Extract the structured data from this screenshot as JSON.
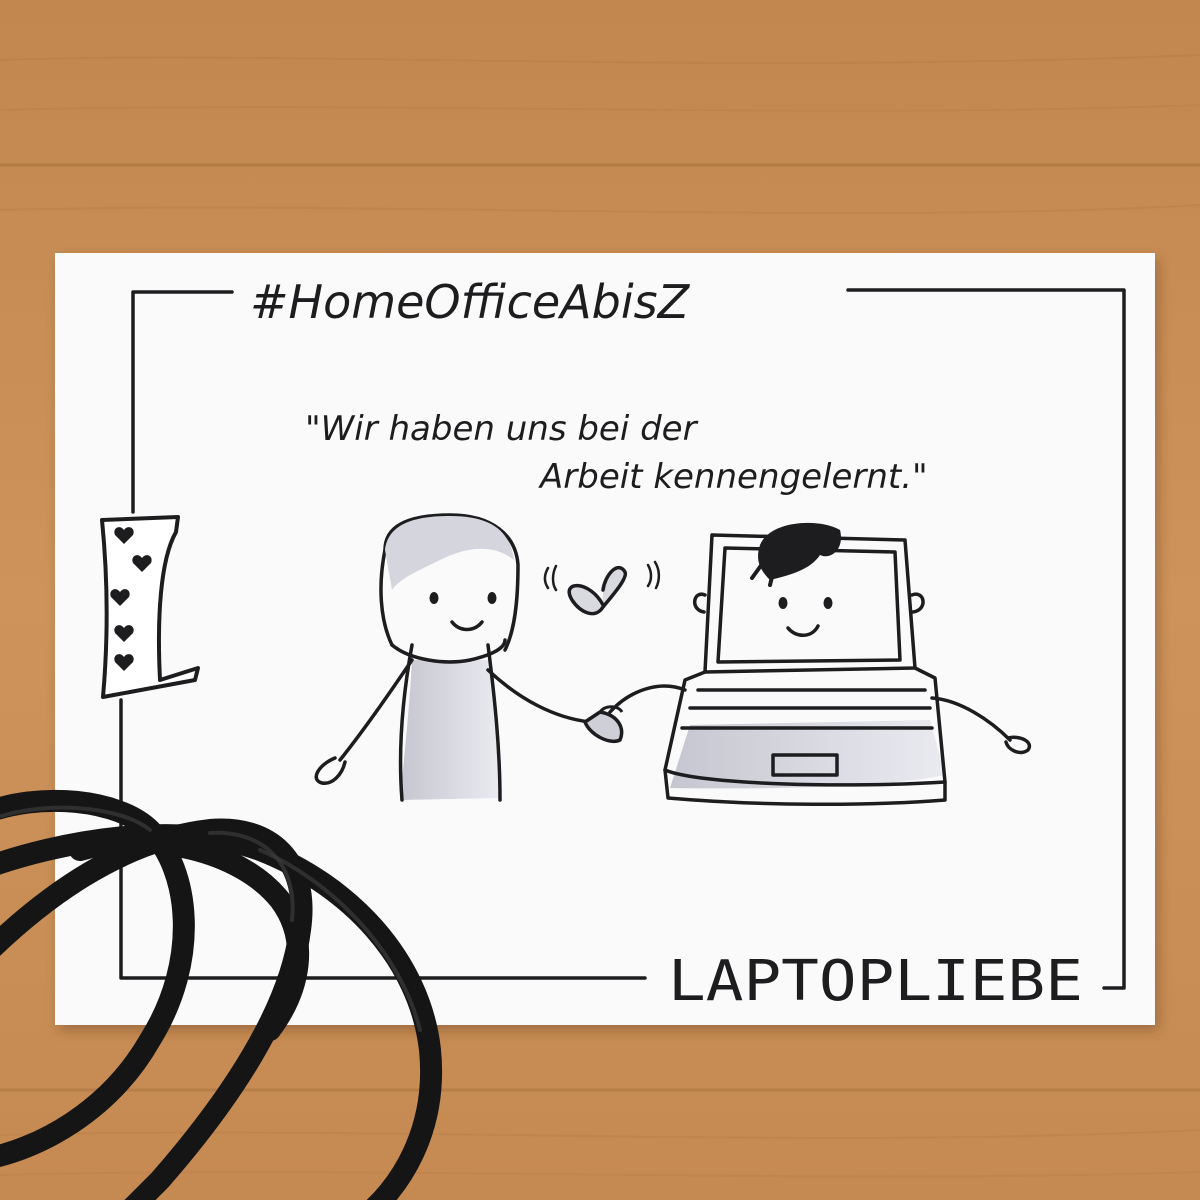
{
  "card": {
    "title": "#HomeOfficeAbisZ",
    "quote_line1": "\"Wir haben uns bei der",
    "quote_line2": "Arbeit kennengelernt.\"",
    "footer": "LAPTOPLIEBE",
    "letter": "L",
    "hearts_in_letter": 5
  },
  "colors": {
    "wood": "#c98e55",
    "card": "#fafafa",
    "ink": "#1d1d1f",
    "shade": "#c9c9d3",
    "cable": "#151515"
  }
}
